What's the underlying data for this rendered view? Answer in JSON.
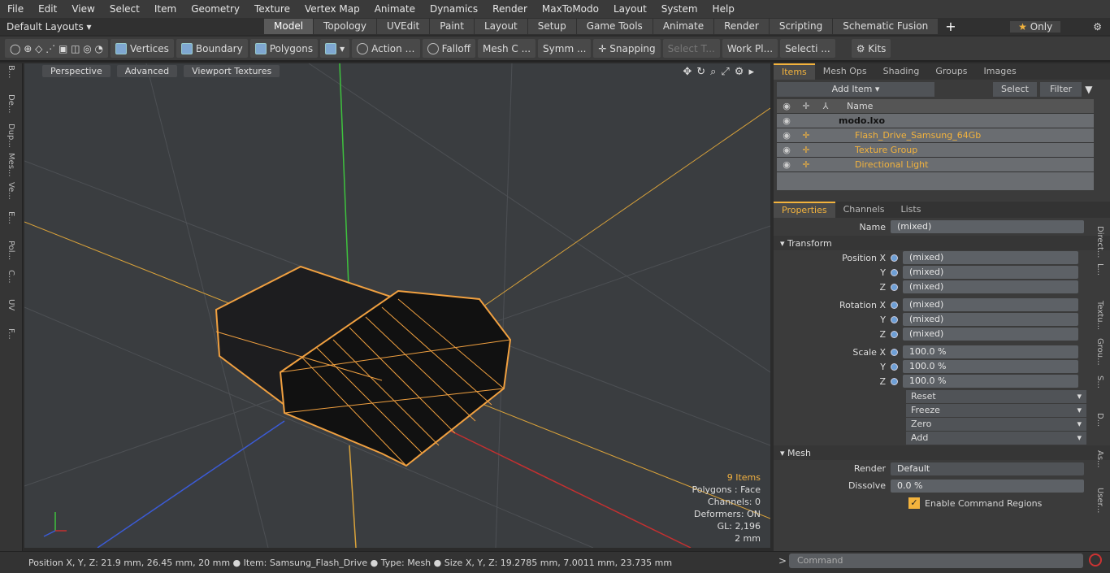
{
  "menu": [
    "File",
    "Edit",
    "View",
    "Select",
    "Item",
    "Geometry",
    "Texture",
    "Vertex Map",
    "Animate",
    "Dynamics",
    "Render",
    "MaxToModo",
    "Layout",
    "System",
    "Help"
  ],
  "layout": {
    "preset": "Default Layouts",
    "only_label": "Only"
  },
  "mode_tabs": [
    "Model",
    "Topology",
    "UVEdit",
    "Paint",
    "Layout",
    "Setup",
    "Game Tools",
    "Animate",
    "Render",
    "Scripting",
    "Schematic Fusion"
  ],
  "toolbar": {
    "vertices": "Vertices",
    "boundary": "Boundary",
    "polygons": "Polygons",
    "action": "Action",
    "falloff": "Falloff",
    "meshc": "Mesh C ...",
    "symm": "Symm ...",
    "snapping": "Snapping",
    "selectt": "Select T...",
    "workpl": "Work Pl...",
    "selecti": "Selecti ...",
    "kits": "Kits"
  },
  "left_strip": [
    "B...",
    "De...",
    "Dup...",
    "Mes...",
    "Ve...",
    "E...",
    "Pol...",
    "C...",
    "UV",
    "F..."
  ],
  "viewport": {
    "perspective": "Perspective",
    "advanced": "Advanced",
    "textures": "Viewport Textures",
    "stats": {
      "items": "9 Items",
      "polygons": "Polygons : Face",
      "channels": "Channels: 0",
      "deformers": "Deformers: ON",
      "gl": "GL: 2,196",
      "unit": "2 mm"
    }
  },
  "status": "Position X, Y, Z:  21.9 mm, 26.45 mm, 20 mm ● Item:  Samsung_Flash_Drive ● Type:  Mesh ● Size X, Y, Z:  19.2785 mm, 7.0011 mm, 23.735 mm",
  "items_panel": {
    "tabs": [
      "Items",
      "Mesh Ops",
      "Shading",
      "Groups",
      "Images"
    ],
    "add_item": "Add Item",
    "select": "Select",
    "filter": "Filter",
    "name_col": "Name",
    "items": [
      {
        "name": "modo.lxo",
        "type": "scene"
      },
      {
        "name": "Flash_Drive_Samsung_64Gb",
        "type": "mesh"
      },
      {
        "name": "Texture Group",
        "type": "group"
      },
      {
        "name": "Directional Light",
        "type": "light"
      }
    ]
  },
  "props": {
    "tabs": [
      "Properties",
      "Channels",
      "Lists"
    ],
    "name_label": "Name",
    "name_value": "(mixed)",
    "transform": "Transform",
    "fields": [
      {
        "label": "Position X",
        "value": "(mixed)"
      },
      {
        "label": "Y",
        "value": "(mixed)"
      },
      {
        "label": "Z",
        "value": "(mixed)"
      },
      {
        "label": "Rotation X",
        "value": "(mixed)"
      },
      {
        "label": "Y",
        "value": "(mixed)"
      },
      {
        "label": "Z",
        "value": "(mixed)"
      },
      {
        "label": "Scale X",
        "value": "100.0 %"
      },
      {
        "label": "Y",
        "value": "100.0 %"
      },
      {
        "label": "Z",
        "value": "100.0 %"
      }
    ],
    "actions": [
      "Reset",
      "Freeze",
      "Zero",
      "Add"
    ],
    "mesh": "Mesh",
    "render_label": "Render",
    "render_value": "Default",
    "dissolve_label": "Dissolve",
    "dissolve_value": "0.0 %",
    "enable_cmd": "Enable Command Regions"
  },
  "right_vtabs": [
    "Direct...",
    "L...",
    "Textu...",
    "Grou...",
    "S...",
    "D...",
    "As...",
    "User..."
  ],
  "command_placeholder": "Command"
}
